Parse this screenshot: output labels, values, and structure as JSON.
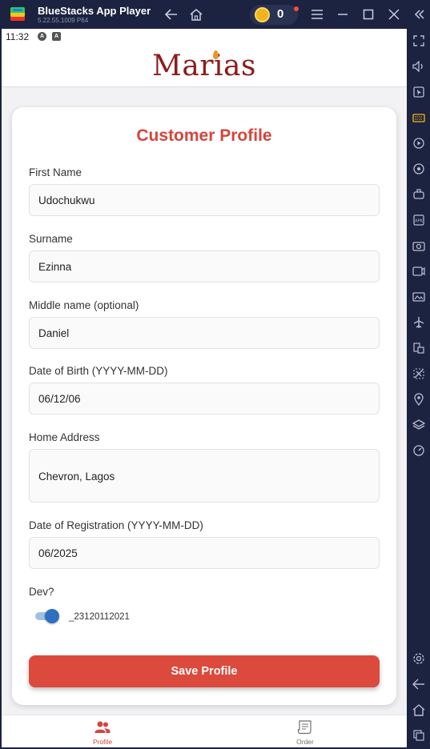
{
  "window": {
    "app_name": "BlueStacks App Player",
    "version": "5.22.55.1009  P64",
    "coin_count": "0"
  },
  "status_bar": {
    "time": "11:32"
  },
  "app": {
    "logo_text": "Marias"
  },
  "profile": {
    "title": "Customer Profile",
    "fields": [
      {
        "label": "First Name",
        "value": "Udochukwu"
      },
      {
        "label": "Surname",
        "value": "Ezinna"
      },
      {
        "label": "Middle name (optional)",
        "value": "Daniel"
      },
      {
        "label": "Date of Birth (YYYY-MM-DD)",
        "value": "06/12/06"
      },
      {
        "label": "Home Address",
        "value": "Chevron, Lagos"
      },
      {
        "label": "Date of Registration (YYYY-MM-DD)",
        "value": "06/2025"
      }
    ],
    "dev_label": "Dev?",
    "dev_toggle_on": true,
    "dev_toggle_text": "_23120112021",
    "save_label": "Save Profile"
  },
  "bottom_nav": [
    {
      "label": "Profile",
      "active": true
    },
    {
      "label": "Order",
      "active": false
    }
  ],
  "colors": {
    "accent": "#dc4a3d",
    "title_red": "#d6453c",
    "logo": "#8c1c1c",
    "toggle": "#2f6fc0",
    "chrome": "#1c2340"
  }
}
